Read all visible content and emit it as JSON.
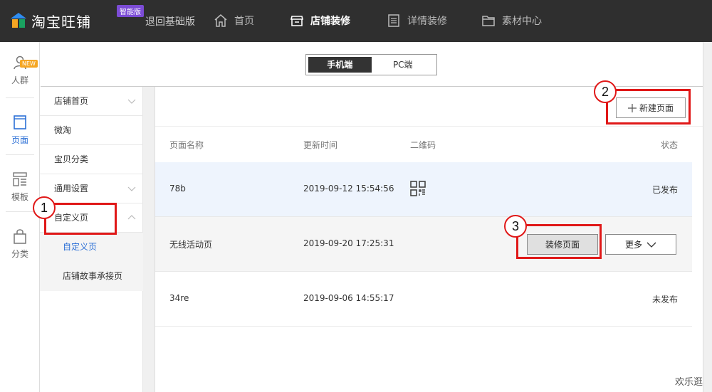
{
  "app": {
    "logo_text": "淘宝旺铺",
    "logo_badge": "智能版",
    "back_link": "退回基础版"
  },
  "topnav": [
    {
      "label": "首页",
      "icon": "home-icon"
    },
    {
      "label": "店铺装修",
      "icon": "shop-icon",
      "active": true
    },
    {
      "label": "详情装修",
      "icon": "document-icon"
    },
    {
      "label": "素材中心",
      "icon": "folder-icon"
    }
  ],
  "rail": {
    "crowd": "人群",
    "crowd_badge": "NEW",
    "page": "页面",
    "template": "模板",
    "category": "分类"
  },
  "subnav": {
    "shop_home": "店铺首页",
    "weitao": "微淘",
    "item_category": "宝贝分类",
    "general_settings": "通用设置",
    "custom_page": "自定义页",
    "custom_page_sub": "自定义页",
    "shop_story": "店铺故事承接页"
  },
  "toggle": {
    "mobile": "手机端",
    "pc": "PC端"
  },
  "actions": {
    "new_page": "新建页面",
    "decorate": "装修页面",
    "more": "更多"
  },
  "table": {
    "headers": [
      "页面名称",
      "更新时间",
      "二维码",
      "状态"
    ],
    "rows": [
      {
        "name": "78b",
        "time": "2019-09-12 15:54:56",
        "status": "已发布"
      },
      {
        "name": "无线活动页",
        "time": "2019-09-20 17:25:31",
        "status": ""
      },
      {
        "name": "34re",
        "time": "2019-09-06 14:55:17",
        "status": "未发布"
      }
    ]
  },
  "callouts": [
    "1",
    "2",
    "3"
  ],
  "annotation_color": "#e01818",
  "watermark": "欢乐逛"
}
